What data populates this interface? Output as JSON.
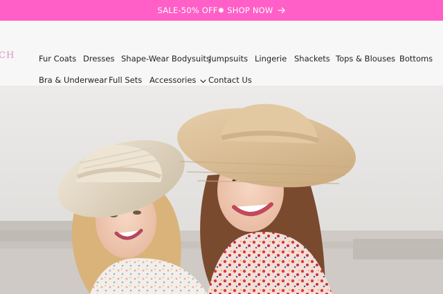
{
  "announcement": {
    "text": "SALE-50% OFF✹ SHOP NOW",
    "arrow_icon": "arrow-right-icon"
  },
  "logo": {
    "fragment": "CH"
  },
  "nav": {
    "row1": [
      "Fur Coats",
      "Dresses",
      "Shape-Wear Bodysuits",
      "Jumpsuits",
      "Lingerie",
      "Shackets",
      "Tops & Blouses",
      "Bottoms"
    ],
    "row2": [
      "Bra & Underwear",
      "Full Sets",
      "Accessories",
      "Contact Us"
    ],
    "accessories_icon": "chevron-down-icon"
  },
  "hero": {
    "alt": "Two smiling women in wide-brim straw hats and floral dresses"
  },
  "colors": {
    "announcement_bg": "#ff5fc6",
    "header_bg": "#f7f7f7",
    "logo_pink": "#e38fc2"
  }
}
